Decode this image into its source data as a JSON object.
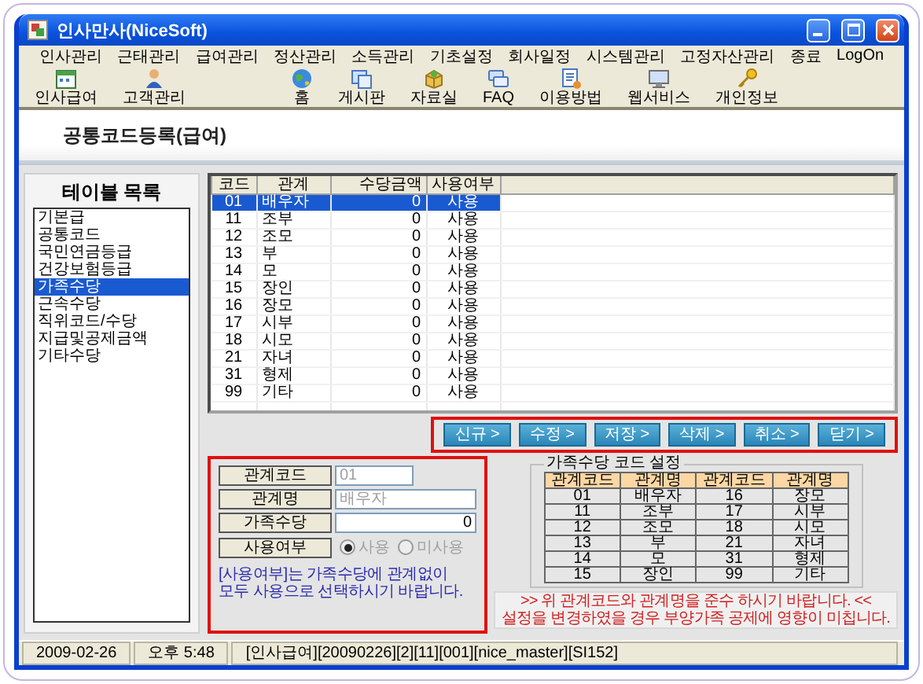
{
  "window": {
    "title": "인사만사(NiceSoft)"
  },
  "menu": [
    "인사관리",
    "근태관리",
    "급여관리",
    "정산관리",
    "소득관리",
    "기초설정",
    "회사일정",
    "시스템관리",
    "고정자산관리",
    "종료",
    "LogOn"
  ],
  "toolbar_left": [
    "인사급여",
    "고객관리"
  ],
  "toolbar_right": [
    "홈",
    "게시판",
    "자료실",
    "FAQ",
    "이용방법",
    "웹서비스",
    "개인정보"
  ],
  "page_title": "공통코드등록(급여)",
  "table_list": {
    "title": "테이블 목록",
    "items": [
      {
        "label": "기본급",
        "selected": false
      },
      {
        "label": "공통코드",
        "selected": false
      },
      {
        "label": "국민연금등급",
        "selected": false
      },
      {
        "label": "건강보험등급",
        "selected": false
      },
      {
        "label": "가족수당",
        "selected": true
      },
      {
        "label": "근속수당",
        "selected": false
      },
      {
        "label": "직위코드/수당",
        "selected": false
      },
      {
        "label": "지급및공제금액",
        "selected": false
      },
      {
        "label": "기타수당",
        "selected": false
      }
    ]
  },
  "grid": {
    "columns": [
      "코드",
      "관계",
      "수당금액",
      "사용여부"
    ],
    "rows": [
      {
        "cells": [
          "01",
          "배우자",
          "0",
          "사용"
        ],
        "selected": true
      },
      {
        "cells": [
          "11",
          "조부",
          "0",
          "사용"
        ],
        "selected": false
      },
      {
        "cells": [
          "12",
          "조모",
          "0",
          "사용"
        ],
        "selected": false
      },
      {
        "cells": [
          "13",
          "부",
          "0",
          "사용"
        ],
        "selected": false
      },
      {
        "cells": [
          "14",
          "모",
          "0",
          "사용"
        ],
        "selected": false
      },
      {
        "cells": [
          "15",
          "장인",
          "0",
          "사용"
        ],
        "selected": false
      },
      {
        "cells": [
          "16",
          "장모",
          "0",
          "사용"
        ],
        "selected": false
      },
      {
        "cells": [
          "17",
          "시부",
          "0",
          "사용"
        ],
        "selected": false
      },
      {
        "cells": [
          "18",
          "시모",
          "0",
          "사용"
        ],
        "selected": false
      },
      {
        "cells": [
          "21",
          "자녀",
          "0",
          "사용"
        ],
        "selected": false
      },
      {
        "cells": [
          "31",
          "형제",
          "0",
          "사용"
        ],
        "selected": false
      },
      {
        "cells": [
          "99",
          "기타",
          "0",
          "사용"
        ],
        "selected": false
      }
    ]
  },
  "actions": {
    "highlighted": true,
    "buttons": [
      "신규 >",
      "수정 >",
      "저장 >",
      "삭제 >",
      "취소 >",
      "닫기 >"
    ]
  },
  "form": {
    "highlighted": true,
    "fields": [
      {
        "kind": "text",
        "label": "관계코드",
        "value": "01",
        "disabled": true
      },
      {
        "kind": "text",
        "label": "관계명",
        "value": "배우자",
        "disabled": true
      },
      {
        "kind": "number",
        "label": "가족수당",
        "value": "0",
        "disabled": false
      },
      {
        "kind": "radio",
        "label": "사용여부",
        "options": [
          {
            "label": "사용",
            "selected": true,
            "disabled": true
          },
          {
            "label": "미사용",
            "selected": false,
            "disabled": true
          }
        ]
      }
    ],
    "note": "[사용여부]는 가족수당에 관계없이 모두 사용으로 선택하시기 바랍니다."
  },
  "code_table": {
    "title": "가족수당 코드 설정",
    "columns": [
      "관계코드",
      "관계명",
      "관계코드",
      "관계명"
    ],
    "rows": [
      [
        "01",
        "배우자",
        "16",
        "장모"
      ],
      [
        "11",
        "조부",
        "17",
        "시부"
      ],
      [
        "12",
        "조모",
        "18",
        "시모"
      ],
      [
        "13",
        "부",
        "21",
        "자녀"
      ],
      [
        "14",
        "모",
        "31",
        "형제"
      ],
      [
        "15",
        "장인",
        "99",
        "기타"
      ]
    ],
    "notices": [
      ">> 위 관계코드와 관계명을 준수 하시기 바랍니다. <<",
      "설정을 변경하였을 경우 부양가족 공제에 영향이 미칩니다."
    ]
  },
  "status_bar": [
    "2009-02-26",
    "오후 5:48",
    "[인사급여][20090226][2][11][001][nice_master][SI152]"
  ]
}
